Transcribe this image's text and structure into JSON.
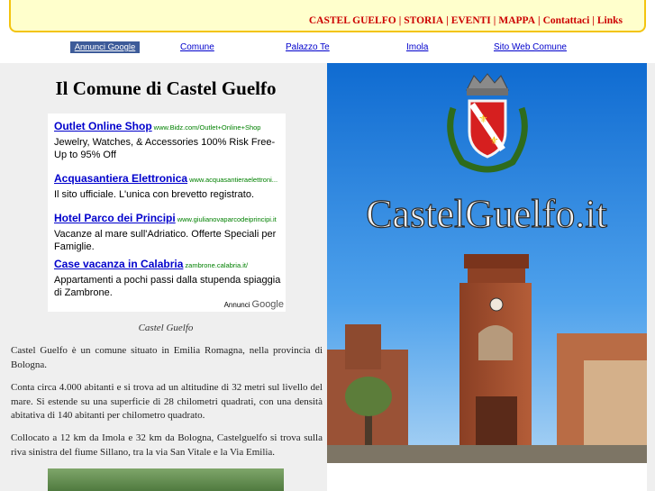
{
  "top_nav": {
    "items": [
      "CASTEL GUELFO",
      "STORIA",
      "EVENTI",
      "MAPPA",
      "Contattaci",
      "Links"
    ],
    "separator": "|"
  },
  "link_unit": {
    "label": "Annunci Google",
    "links": [
      "Comune",
      "Palazzo Te",
      "Imola",
      "Sito Web Comune"
    ]
  },
  "content": {
    "title": "Il Comune di Castel Guelfo",
    "caption": "Castel Guelfo",
    "paragraphs": [
      "Castel Guelfo è un comune situato in Emilia Romagna, nella provincia di Bologna.",
      "Conta circa 4.000 abitanti e si trova ad un altitudine di 32 metri sul livello del mare. Si estende su una superficie di 28 chilometri quadrati, con una densità abitativa di 140 abitanti per chilometro quadrato.",
      "Collocato a 12 km da Imola e 32 km da Bologna, Castelguelfo si trova sulla riva sinistra del fiume Sillano, tra la via San Vitale e la Via Emilia."
    ]
  },
  "ads": {
    "items": [
      {
        "title": "Outlet Online Shop",
        "url": "www.Bidz.com/Outlet+Online+Shop",
        "desc": "Jewelry, Watches, & Accessories 100% Risk Free-Up to 95% Off"
      },
      {
        "title": "Acquasantiera Elettronica",
        "url": "www.acquasantieraelettroni...",
        "desc": "Il sito ufficiale. L'unica con brevetto registrato."
      },
      {
        "title": "Hotel Parco dei Principi",
        "url": "www.giulianovaparcodeiprincipi.it",
        "desc": "Vacanze al mare sull'Adriatico. Offerte Speciali per Famiglie."
      },
      {
        "title": "Case vacanza in Calabria",
        "url": "zambrone.calabria.it/",
        "desc": "Appartamenti a pochi passi dalla stupenda spiaggia di Zambrone."
      }
    ],
    "ads_by_label": "Annunci",
    "ads_by_brand": "Google"
  },
  "photo": {
    "overlay_text": "CastelGuelfo.it"
  },
  "colors": {
    "header_bg": "#ffffcc",
    "header_border": "#f3c40e",
    "nav_text": "#cc0000",
    "link_blue": "#0000cc",
    "ad_url_green": "#008000",
    "panel_bg": "#efefef"
  }
}
